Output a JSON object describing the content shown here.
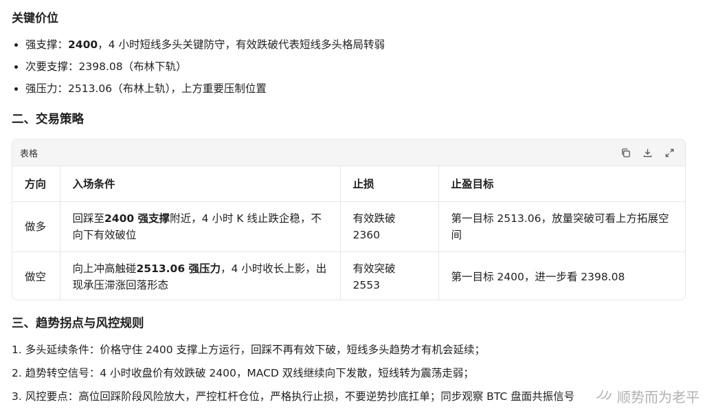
{
  "section_key_levels": {
    "title": "关键价位",
    "items": [
      {
        "label": "强支撑：",
        "bold_value": "2400",
        "rest": "，4 小时短线多头关键防守，有效跌破代表短线多头格局转弱"
      },
      {
        "label": "次要支撑：",
        "bold_value": "",
        "rest": "2398.08（布林下轨）"
      },
      {
        "label": "强压力：",
        "bold_value": "",
        "rest": "2513.06（布林上轨），上方重要压制位置"
      }
    ]
  },
  "section_strategy": {
    "title": "二、交易策略",
    "card_title": "表格",
    "icons": [
      "copy-icon",
      "download-icon",
      "expand-icon"
    ],
    "headers": [
      "方向",
      "入场条件",
      "止损",
      "止盈目标"
    ],
    "rows": [
      {
        "direction": "做多",
        "entry_pre": "回踩至",
        "entry_bold": "2400 强支撑",
        "entry_post": "附近，4 小时 K 线止跌企稳，不向下有效破位",
        "stop": "有效跌破 2360",
        "target": "第一目标 2513.06，放量突破可看上方拓展空间"
      },
      {
        "direction": "做空",
        "entry_pre": "向上冲高触碰",
        "entry_bold": "2513.06 强压力",
        "entry_post": "，4 小时收长上影，出现承压滞涨回落形态",
        "stop": "有效突破 2553",
        "target": "第一目标 2400，进一步看 2398.08"
      }
    ]
  },
  "section_rules": {
    "title": "三、趋势拐点与风控规则",
    "items": [
      "1. 多头延续条件：价格守住 2400 支撑上方运行，回踩不再有效下破，短线多头趋势才有机会延续；",
      "2. 趋势转空信号：4 小时收盘价有效跌破 2400，MACD 双线继续向下发散，短线转为震荡走弱；",
      "3. 风控要点：高位回踩阶段风险放大，严控杠杆仓位，严格执行止损，不要逆势抄底扛单；同步观察 BTC 盘面共振信号"
    ]
  },
  "watermark": {
    "text": "顺势而为老平"
  }
}
